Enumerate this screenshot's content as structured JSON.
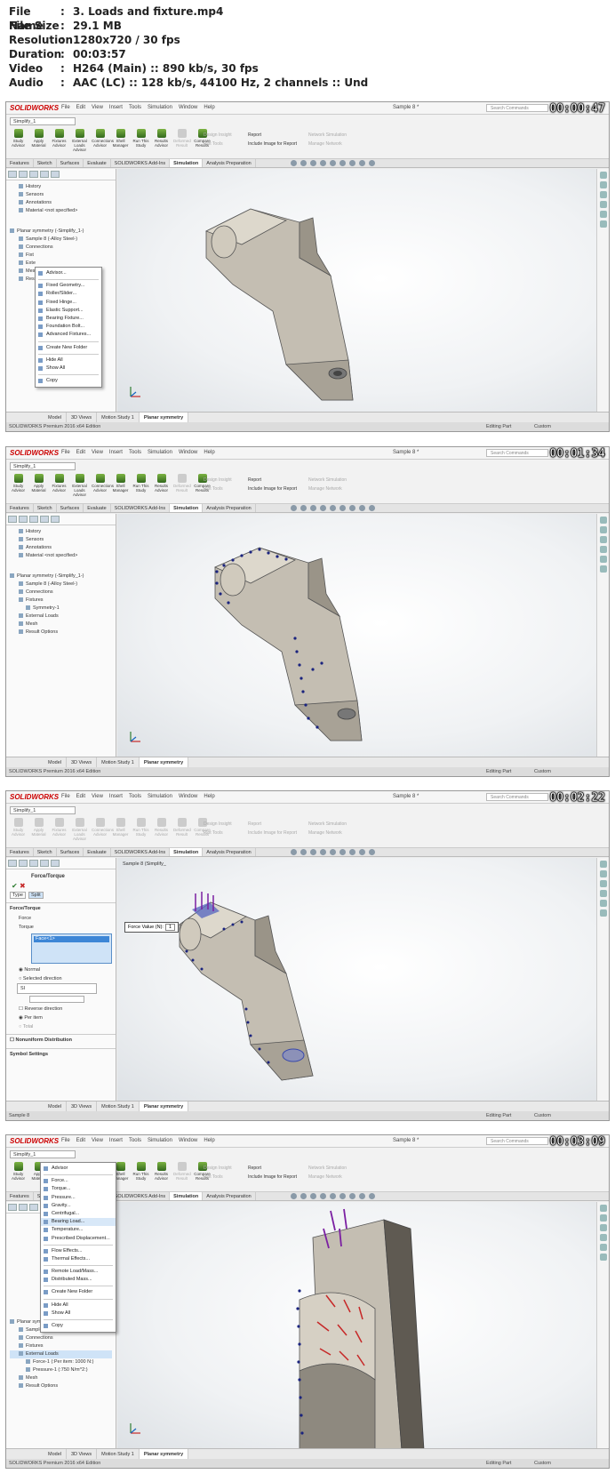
{
  "info": {
    "rows": [
      {
        "key": "File Name",
        "value": "3. Loads and fixture.mp4"
      },
      {
        "key": "File Size",
        "value": "29.1 MB"
      },
      {
        "key": "Resolution",
        "value": "1280x720 / 30 fps"
      },
      {
        "key": "Duration",
        "value": "00:03:57"
      },
      {
        "key": "Video",
        "value": "H264 (Main) :: 890 kb/s, 30 fps"
      },
      {
        "key": "Audio",
        "value": "AAC (LC) :: 128 kb/s, 44100 Hz, 2 channels :: Und"
      }
    ],
    "colon": ":"
  },
  "app": {
    "logo": "SOLIDWORKS",
    "menus": [
      "File",
      "Edit",
      "View",
      "Insert",
      "Tools",
      "Simulation",
      "Window",
      "Help"
    ],
    "doc_title": "Sample 8 *",
    "search_placeholder": "Search Commands",
    "config": "Simplify_1",
    "tools": [
      "Study Advisor",
      "Apply Material",
      "Fixtures Advisor",
      "External Loads Advisor",
      "Connections Advisor",
      "Shell Manager",
      "Run This Study",
      "Results Advisor",
      "Deformed Result",
      "Compare Results"
    ],
    "mid_links": [
      "Design Insight",
      "Plot Tools"
    ],
    "report_links": [
      "Report",
      "Include Image for Report"
    ],
    "net_links": [
      "Network Simulation",
      "Manage Network"
    ],
    "cmd_tabs": [
      "Features",
      "Sketch",
      "Surfaces",
      "Evaluate",
      "SOLIDWORKS Add-Ins",
      "Simulation",
      "Analysis Preparation"
    ],
    "bottom_tabs": [
      "Model",
      "3D Views",
      "Motion Study 1",
      "Planar symmetry"
    ],
    "status_left": "SOLIDWORKS Premium 2016 x64 Edition",
    "status_left_f3": "Sample 8",
    "status_editing": "Editing Part",
    "status_custom": "Custom"
  },
  "frames": {
    "f1": {
      "timestamp": "00:00:47",
      "tree": [
        "History",
        "Sensors",
        "Annotations",
        "Material <not specified>",
        "Planar symmetry (-Simplify_1-)",
        "Sample 8 (-Alloy Steel-)",
        "Connections",
        "Fixt",
        "Exte",
        "Mes",
        "Resu"
      ],
      "menu": [
        "Advisor...",
        "Fixed Geometry...",
        "Roller/Slider...",
        "Fixed Hinge...",
        "Elastic Support...",
        "Bearing Fixture...",
        "Foundation Bolt...",
        "Advanced Fixtures...",
        "Create New Folder",
        "Hide All",
        "Show All",
        "Copy"
      ]
    },
    "f2": {
      "timestamp": "00:01:34",
      "tree": [
        "History",
        "Sensors",
        "Annotations",
        "Material <not specified>",
        "Planar symmetry (-Simplify_1-)",
        "Sample 8 (-Alloy Steel-)",
        "Connections",
        "Fixtures",
        "Symmetry-1",
        "External Loads",
        "Mesh",
        "Result Options"
      ]
    },
    "f3": {
      "timestamp": "00:02:22",
      "pm_title": "Force/Torque",
      "tabs": [
        "Type",
        "Split"
      ],
      "section1": "Force/Torque",
      "force": "Force",
      "torque": "Torque",
      "face": "Face<1>",
      "normal": "Normal",
      "selected_direction": "Selected direction",
      "unit": "SI",
      "reverse": "Reverse direction",
      "per_item": "Per item",
      "total": "Total",
      "nonuniform": "Nonuniform Distribution",
      "symbol": "Symbol Settings",
      "callout_label": "Force Value (N):",
      "callout_value": "1",
      "tree_flyout": "Sample 8 (Simplify_"
    },
    "f4": {
      "timestamp": "00:03:09",
      "tree": [
        "Planar symmetry",
        "Sample 8",
        "Connections",
        "Fixtures",
        "External Loads",
        "Force-1 (:Per item: 1000 N:)",
        "Pressure-1 (:750 N/m^2:)",
        "Mesh",
        "Result Options"
      ],
      "menu": [
        "Advisor",
        "Force...",
        "Torque...",
        "Pressure...",
        "Gravity...",
        "Centrifugal...",
        "Bearing Load...",
        "Temperature...",
        "Prescribed Displacement...",
        "Flow Effects...",
        "Thermal Effects...",
        "Remote Load/Mass...",
        "Distributed Mass...",
        "Create New Folder",
        "Hide All",
        "Show All",
        "Copy"
      ]
    }
  },
  "colors": {
    "accent": "#c00000",
    "selection": "#3d86d6",
    "fixture_arrows": "#1a237e",
    "force_arrows": "#7b1fa2",
    "pressure_arrows": "#c62828"
  }
}
